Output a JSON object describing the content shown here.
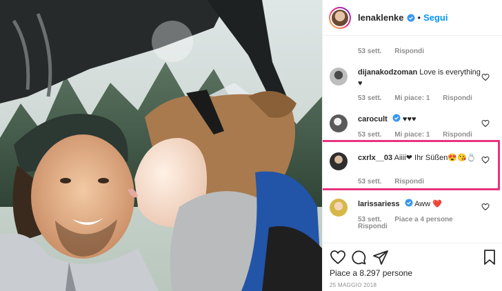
{
  "post": {
    "username": "lenaklenke",
    "follow_label": "Segui",
    "separator": "•"
  },
  "comments": [
    {
      "id": "partial",
      "time": "53 sett.",
      "reply": "Rispondi"
    },
    {
      "id": "dijana",
      "user": "dijanakodzoman",
      "text": "Love is everything ♥",
      "time": "53 sett.",
      "likes": "Mi piace: 1",
      "reply": "Rispondi"
    },
    {
      "id": "carocult",
      "user": "carocult",
      "text": "♥♥♥",
      "time": "53 sett.",
      "likes": "Mi piace: 1",
      "reply": "Rispondi"
    },
    {
      "id": "cxrlx",
      "user": "cxrlx__03",
      "text": "Aiiii❤ Ihr Süßen😍😘💍",
      "time": "53 sett.",
      "reply": "Rispondi"
    },
    {
      "id": "larissa",
      "user": "larissariess",
      "text": "Aww ❤️",
      "time": "53 sett.",
      "likes": "Piace a 4 persone",
      "reply": "Rispondi"
    }
  ],
  "footer": {
    "likes_text": "Piace a 8.297 persone",
    "date": "25 MAGGIO 2018"
  },
  "icons": {
    "verified": "verified-badge-icon",
    "like": "heart-icon",
    "comment": "comment-icon",
    "share": "share-icon",
    "save": "bookmark-icon"
  },
  "colors": {
    "link_blue": "#0095f6",
    "highlight": "#e8327e",
    "meta_gray": "#8e8e8e"
  }
}
